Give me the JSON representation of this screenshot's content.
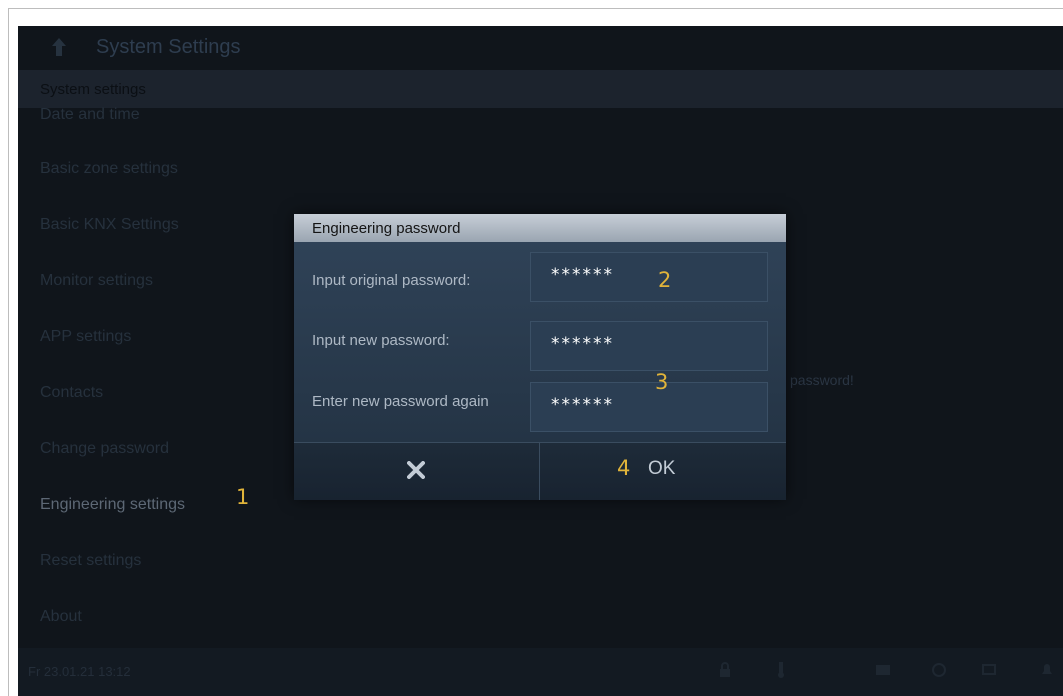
{
  "header": {
    "title": "System Settings"
  },
  "section": {
    "label": "System settings"
  },
  "menu": [
    {
      "label": "Date and time"
    },
    {
      "label": "Basic zone settings"
    },
    {
      "label": "Basic KNX Settings"
    },
    {
      "label": "Monitor settings"
    },
    {
      "label": "APP settings"
    },
    {
      "label": "Contacts"
    },
    {
      "label": "Change password"
    },
    {
      "label": "Engineering settings"
    },
    {
      "label": "Reset settings"
    },
    {
      "label": "About"
    }
  ],
  "background_message": "password!",
  "statusbar": {
    "datetime": "Fr 23.01.21  13:12"
  },
  "dialog": {
    "title": "Engineering password",
    "fields": [
      {
        "label": "Input original password:",
        "value": "******"
      },
      {
        "label": "Input new password:",
        "value": "******"
      },
      {
        "label": "Enter new password again",
        "value": "******"
      }
    ],
    "cancel_icon": "close-icon",
    "ok_label": "OK"
  },
  "markers": [
    "1",
    "2",
    "3",
    "4"
  ],
  "colors": {
    "marker": "#e1b43a",
    "dialog_header": "#b3bcc7",
    "dialog_body": "#2b3c4f"
  }
}
